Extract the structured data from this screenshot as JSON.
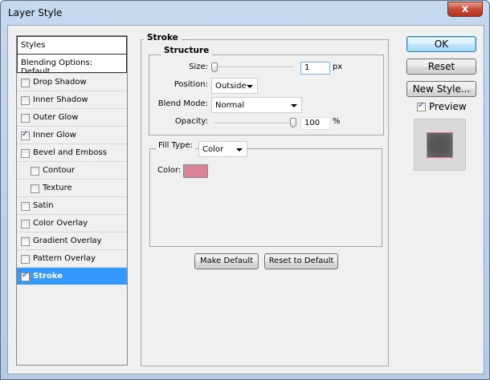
{
  "window": {
    "title": "Layer Style",
    "close_label": "x"
  },
  "sidebar": {
    "header": "Styles",
    "blending": "Blending Options: Default",
    "items": [
      {
        "label": "Drop Shadow",
        "checked": false,
        "indent": false
      },
      {
        "label": "Inner Shadow",
        "checked": false,
        "indent": false
      },
      {
        "label": "Outer Glow",
        "checked": false,
        "indent": false
      },
      {
        "label": "Inner Glow",
        "checked": true,
        "indent": false
      },
      {
        "label": "Bevel and Emboss",
        "checked": false,
        "indent": false
      },
      {
        "label": "Contour",
        "checked": false,
        "indent": true
      },
      {
        "label": "Texture",
        "checked": false,
        "indent": true
      },
      {
        "label": "Satin",
        "checked": false,
        "indent": false
      },
      {
        "label": "Color Overlay",
        "checked": false,
        "indent": false
      },
      {
        "label": "Gradient Overlay",
        "checked": false,
        "indent": false
      },
      {
        "label": "Pattern Overlay",
        "checked": false,
        "indent": false
      },
      {
        "label": "Stroke",
        "checked": true,
        "indent": false,
        "selected": true
      }
    ]
  },
  "stroke": {
    "title": "Stroke",
    "structure": {
      "title": "Structure",
      "size_label": "Size:",
      "size_value": "1",
      "size_unit": "px",
      "size_slider_fraction": 0.0,
      "position_label": "Position:",
      "position_value": "Outside",
      "blend_label": "Blend Mode:",
      "blend_value": "Normal",
      "opacity_label": "Opacity:",
      "opacity_value": "100",
      "opacity_unit": "%",
      "opacity_fraction": 1.0
    },
    "fill": {
      "type_label": "Fill Type:",
      "type_value": "Color",
      "color_label": "Color:",
      "color": "#dd8399"
    },
    "make_default": "Make Default",
    "reset_default": "Reset to Default"
  },
  "actions": {
    "ok": "OK",
    "reset": "Reset",
    "new_style": "New Style...",
    "preview_label": "Preview",
    "preview_checked": true,
    "preview_stroke": "#dd6f8b"
  }
}
